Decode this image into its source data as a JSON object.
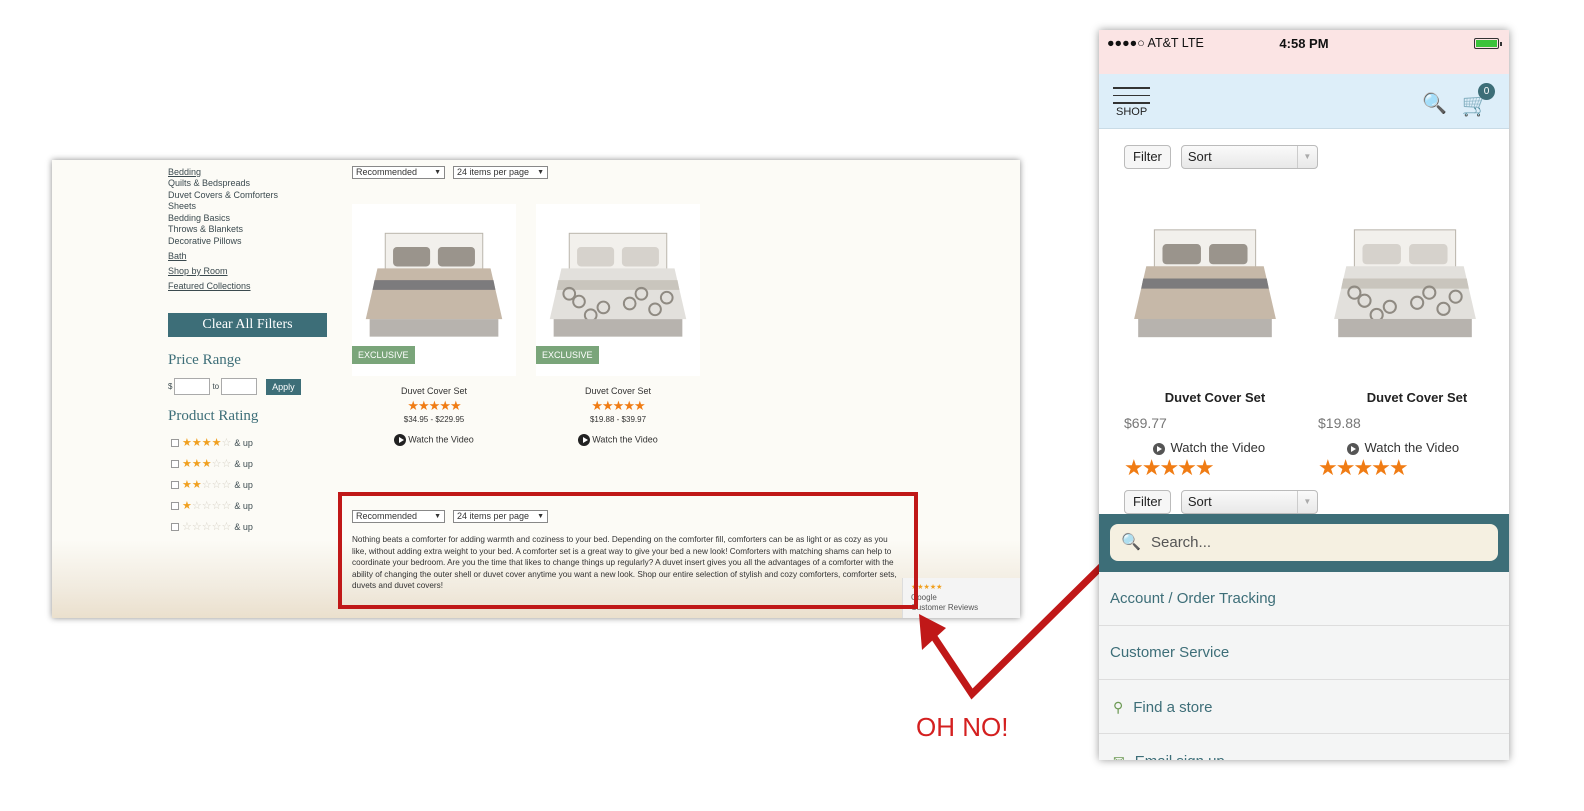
{
  "desktop": {
    "categories": [
      {
        "label": "Bedding",
        "main": true
      },
      {
        "label": "Quilts & Bedspreads",
        "main": false
      },
      {
        "label": "Duvet Covers & Comforters",
        "main": false
      },
      {
        "label": "Sheets",
        "main": false
      },
      {
        "label": "Bedding Basics",
        "main": false
      },
      {
        "label": "Throws & Blankets",
        "main": false
      },
      {
        "label": "Decorative Pillows",
        "main": false
      },
      {
        "label": "Bath",
        "main": true
      },
      {
        "label": "Shop by Room",
        "main": true
      },
      {
        "label": "Featured Collections",
        "main": true
      }
    ],
    "clear_filters_label": "Clear All Filters",
    "price_range": {
      "title": "Price Range",
      "currency": "$",
      "to": "to",
      "apply": "Apply"
    },
    "product_rating": {
      "title": "Product Rating",
      "suffix": "& up",
      "rows": [
        {
          "stars": 4
        },
        {
          "stars": 3
        },
        {
          "stars": 2
        },
        {
          "stars": 1
        },
        {
          "stars": 0
        }
      ]
    },
    "sort_select": "Recommended",
    "per_page_select": "24 items per page",
    "products": [
      {
        "badge": "EXCLUSIVE",
        "name": "Duvet Cover Set",
        "rating": 5,
        "price": "$34.95 - $229.95",
        "video": "Watch the Video"
      },
      {
        "badge": "EXCLUSIVE",
        "name": "Duvet Cover Set",
        "rating": 5,
        "price": "$19.88 - $39.97",
        "video": "Watch the Video"
      }
    ],
    "description": "Nothing beats a comforter for adding warmth and coziness to your bed. Depending on the comforter fill, comforters can be as light or as cozy as you like, without adding extra weight to your bed. A comforter set is a great way to give your bed a new look! Comforters with matching shams can help to coordinate your bedroom. Are you the time that likes to change things up regularly? A duvet insert gives you all the advantages of a comforter with the ability of changing the outer shell or duvet cover anytime you want a new look. Shop our entire selection of stylish and cozy comforters, comforter sets, duvets and duvet covers!",
    "review_badge": {
      "stars": "★★★★★",
      "line1": "Google",
      "line2": "Customer Reviews"
    }
  },
  "annotation": {
    "text": "OH NO!",
    "color": "#c01818"
  },
  "mobile": {
    "status": {
      "carrier": "●●●●○ AT&T  LTE",
      "time": "4:58 PM"
    },
    "header": {
      "menu_label": "SHOP",
      "cart_count": "0"
    },
    "filter_label": "Filter",
    "sort_label": "Sort",
    "products": [
      {
        "name": "Duvet Cover Set",
        "price": "$69.77",
        "video": "Watch the Video",
        "rating": 5
      },
      {
        "name": "Duvet Cover Set",
        "price": "$19.88",
        "video": "Watch the Video",
        "rating": 5
      }
    ],
    "sticky_filter_label": "Filter",
    "sticky_sort_label": "Sort",
    "search_placeholder": "Search...",
    "menu_items": [
      "Account / Order Tracking",
      "Customer Service",
      "Find a store",
      "Email sign up"
    ]
  },
  "colors": {
    "teal": "#3d6e78",
    "star_orange": "#f07c14",
    "exclusive_green": "#7aa57a",
    "status_pink": "#fbe4e4",
    "header_blue": "#ddeef9"
  }
}
